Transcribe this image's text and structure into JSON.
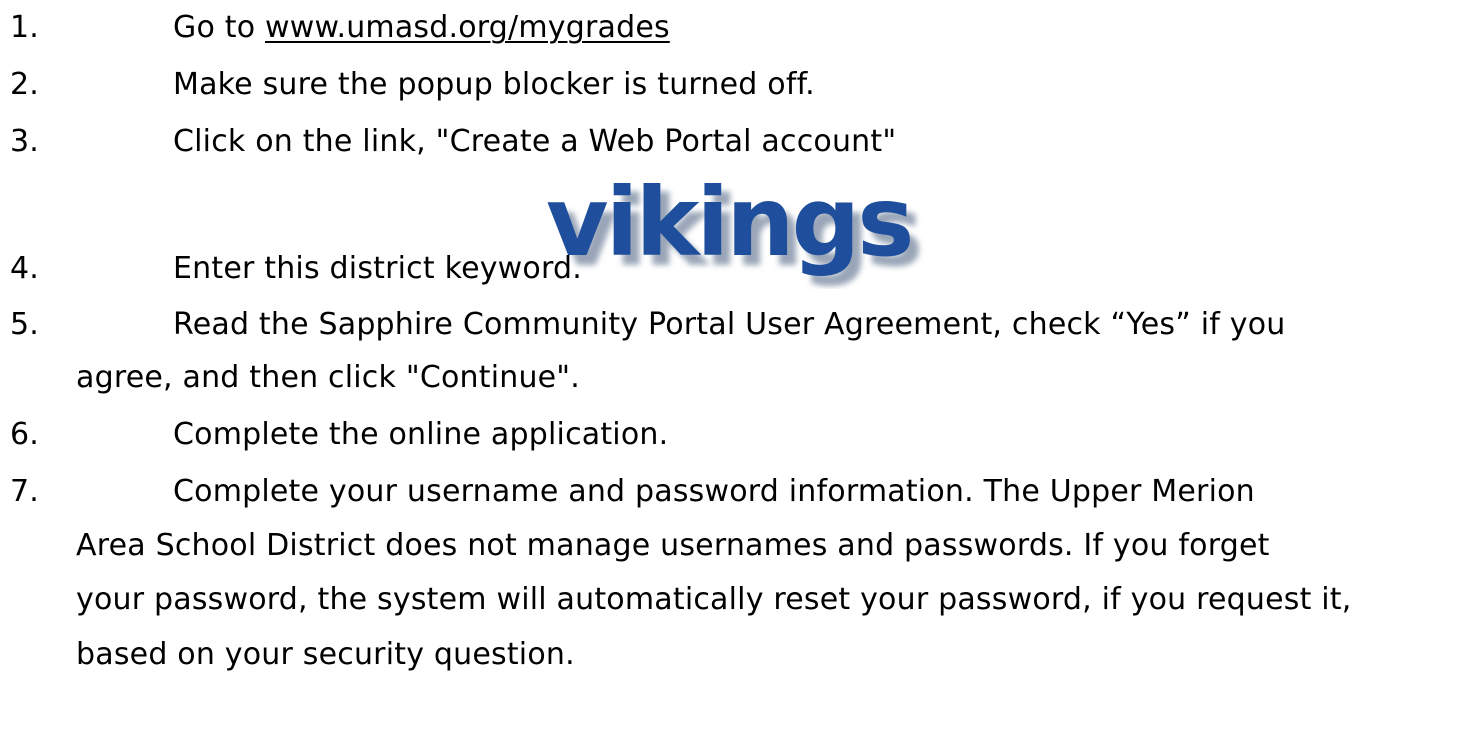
{
  "steps": [
    {
      "num": "1.",
      "prefix": "Go to ",
      "link": "www.umasd.org/mygrades"
    },
    {
      "num": "2.",
      "text": "Make sure the popup blocker is turned off."
    },
    {
      "num": "3.",
      "text": "Click on the link, \"Create a Web Portal account\""
    },
    {
      "num": "4.",
      "text": "Enter this district keyword."
    },
    {
      "num": "5.",
      "lines": [
        "Read the Sapphire Community Portal User Agreement, check “Yes” if you",
        "agree, and then click \"Continue\"."
      ]
    },
    {
      "num": "6.",
      "text": "Complete the online application."
    },
    {
      "num": "7.",
      "lines": [
        "Complete your username and password information. The Upper Merion",
        "Area School District does not manage usernames and passwords. If you forget",
        "your password, the system will automatically reset your password, if you request it,",
        "based on your security question."
      ]
    }
  ],
  "keyword_logo": {
    "text": "vikings",
    "color": "#1f4f9c",
    "shadow_color": "#9aa6b8"
  }
}
